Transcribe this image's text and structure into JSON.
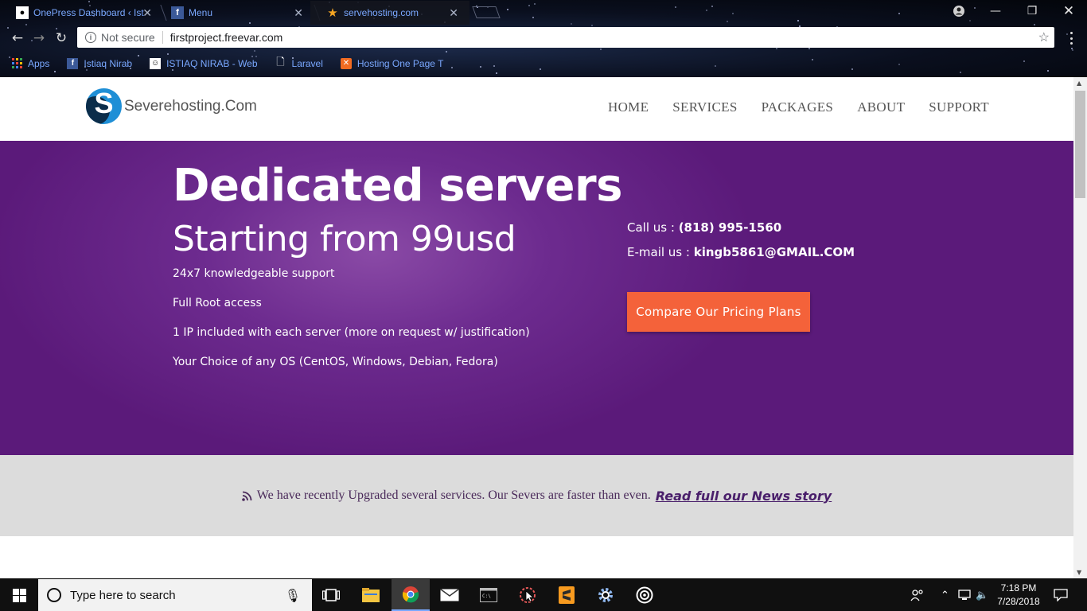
{
  "browser": {
    "tabs": [
      {
        "title": "OnePress Dashboard ‹ Ist",
        "favicon": "wordpress-icon",
        "active": false
      },
      {
        "title": "Menu",
        "favicon": "facebook-icon",
        "active": false
      },
      {
        "title": "servehosting.com",
        "favicon": "star-icon",
        "active": true
      }
    ],
    "address": {
      "security_label": "Not secure",
      "url": "firstproject.freevar.com"
    },
    "bookmarks": [
      {
        "label": "Apps",
        "icon": "apps-grid-icon"
      },
      {
        "label": "Istiaq Nirab",
        "icon": "facebook-icon"
      },
      {
        "label": "ISTIAQ NIRAB - Web",
        "icon": "profile-icon"
      },
      {
        "label": "Laravel",
        "icon": "page-icon"
      },
      {
        "label": "Hosting One Page T",
        "icon": "template-icon"
      }
    ]
  },
  "site": {
    "logo_letter": "S",
    "logo_text": "Severehosting.Com",
    "nav": [
      "HOME",
      "SERVICES",
      "PACKAGES",
      "ABOUT",
      "SUPPORT"
    ],
    "hero": {
      "title": "Dedicated servers",
      "subtitle": "Starting from 99usd",
      "features": [
        "24x7 knowledgeable support",
        "Full Root access",
        "1 IP included with each server (more on request w/ justification)",
        "Your Choice of any OS (CentOS, Windows, Debian, Fedora)"
      ],
      "call_label": "Call us : ",
      "phone": "(818) 995-1560",
      "email_label": "E-mail us : ",
      "email": "kingb5861@GMAIL.COM",
      "cta": "Compare Our Pricing Plans"
    },
    "news": {
      "text": "We have recently Upgraded several services. Our Severs are faster than even.",
      "link": "Read full our News story"
    }
  },
  "taskbar": {
    "search_placeholder": "Type here to search",
    "time": "7:18 PM",
    "date": "7/28/2018"
  },
  "colors": {
    "hero_purple": "#5b1a7a",
    "cta_orange": "#f4623a",
    "logo_blue": "#1f8fd6",
    "news_bg": "#dcdcdc"
  }
}
